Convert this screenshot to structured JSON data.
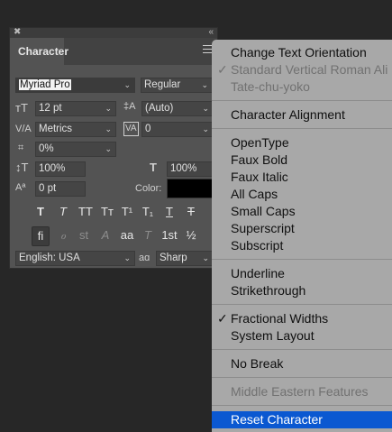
{
  "panel": {
    "title": "Character",
    "font_family": "Myriad Pro",
    "font_style": "Regular",
    "font_size": "12 pt",
    "leading": "(Auto)",
    "kerning": "Metrics",
    "tracking": "0",
    "tsume": "0%",
    "vertical_scale": "100%",
    "horizontal_scale": "100%",
    "baseline_shift": "0 pt",
    "color_label": "Color:",
    "color_value": "#000000",
    "language": "English: USA",
    "antialias_icon_text": "aɑ",
    "antialias": "Sharp",
    "style_buttons": [
      "T",
      "T",
      "TT",
      "Tт",
      "T¹",
      "T₁",
      "T",
      "T"
    ],
    "opentype_buttons": [
      "fi",
      "ℴ",
      "st",
      "A",
      "aa",
      "T",
      "1st",
      "½"
    ]
  },
  "menu": {
    "items": [
      {
        "label": "Change Text Orientation",
        "disabled": false,
        "check": ""
      },
      {
        "label": "Standard Vertical Roman Ali",
        "disabled": true,
        "check": "✓"
      },
      {
        "label": "Tate-chu-yoko",
        "disabled": true,
        "check": ""
      },
      {
        "label": "Character Alignment",
        "disabled": false,
        "check": ""
      },
      {
        "label": "OpenType",
        "disabled": false,
        "check": ""
      },
      {
        "label": "Faux Bold",
        "disabled": false,
        "check": ""
      },
      {
        "label": "Faux Italic",
        "disabled": false,
        "check": ""
      },
      {
        "label": "All Caps",
        "disabled": false,
        "check": ""
      },
      {
        "label": "Small Caps",
        "disabled": false,
        "check": ""
      },
      {
        "label": "Superscript",
        "disabled": false,
        "check": ""
      },
      {
        "label": "Subscript",
        "disabled": false,
        "check": ""
      },
      {
        "label": "Underline",
        "disabled": false,
        "check": ""
      },
      {
        "label": "Strikethrough",
        "disabled": false,
        "check": ""
      },
      {
        "label": "Fractional Widths",
        "disabled": false,
        "check": "✓"
      },
      {
        "label": "System Layout",
        "disabled": false,
        "check": ""
      },
      {
        "label": "No Break",
        "disabled": false,
        "check": ""
      },
      {
        "label": "Middle Eastern Features",
        "disabled": true,
        "check": ""
      },
      {
        "label": "Reset Character",
        "disabled": false,
        "check": "",
        "highlighted": true
      }
    ]
  }
}
